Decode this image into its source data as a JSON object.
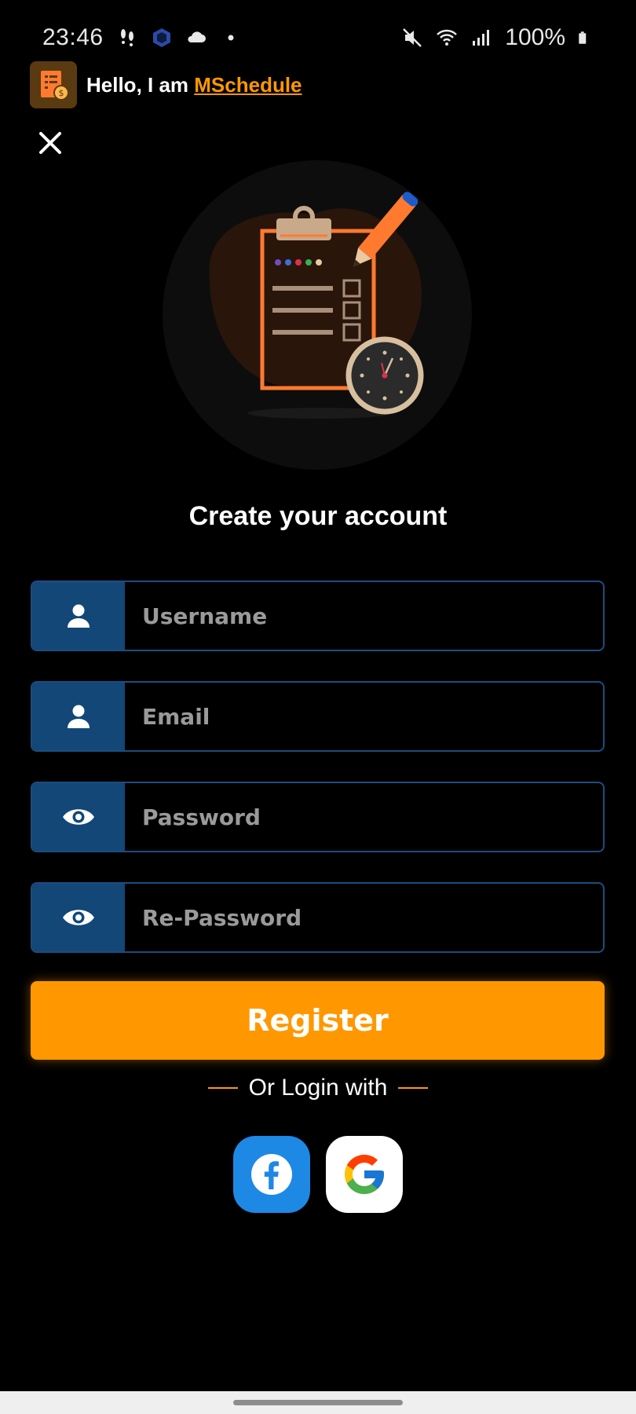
{
  "status_bar": {
    "time": "23:46",
    "battery": "100%",
    "left_icons": [
      "steps-icon",
      "app-cube-icon",
      "cloud-icon",
      "dot-icon"
    ],
    "right_icons": [
      "mute-icon",
      "wifi-icon",
      "signal-icon",
      "battery-icon"
    ]
  },
  "header": {
    "greeting_prefix": "Hello, I am ",
    "brand": "MSchedule"
  },
  "page": {
    "title": "Create your account"
  },
  "form": {
    "username_placeholder": "Username",
    "email_placeholder": "Email",
    "password_placeholder": "Password",
    "repassword_placeholder": "Re-Password",
    "register_label": "Register"
  },
  "social": {
    "or_label": "Or Login with",
    "providers": [
      "Facebook",
      "Google"
    ]
  },
  "colors": {
    "accent": "#ff9800",
    "field_icon_bg": "#124777",
    "field_border": "#1c4d80",
    "facebook": "#1e88e5",
    "background": "#000000"
  }
}
